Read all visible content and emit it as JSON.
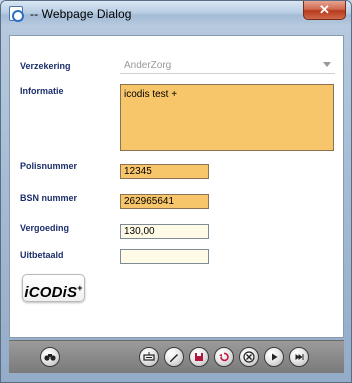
{
  "window": {
    "title": "-- Webpage Dialog",
    "close_label": "✕"
  },
  "form": {
    "verzekering_label": "Verzekering",
    "verzekering_value": "AnderZorg",
    "informatie_label": "Informatie",
    "informatie_value": "icodis test +",
    "polisnummer_label": "Polisnummer",
    "polisnummer_value": "12345",
    "bsn_label": "BSN nummer",
    "bsn_value": "262965641",
    "vergoeding_label": "Vergoeding",
    "vergoeding_value": "130,00",
    "uitbetaald_label": "Uitbetaald",
    "uitbetaald_value": ""
  },
  "logo": {
    "text": "iCODiS",
    "plus": "+"
  },
  "toolbar": {
    "buttons": [
      {
        "name": "search-icon"
      },
      {
        "name": "keyboard-icon"
      },
      {
        "name": "edit-icon"
      },
      {
        "name": "save-icon"
      },
      {
        "name": "undo-icon"
      },
      {
        "name": "delete-icon"
      },
      {
        "name": "next-icon"
      },
      {
        "name": "last-icon"
      }
    ]
  },
  "colors": {
    "field_orange": "#f8c66a",
    "label_navy": "#1c2f6b",
    "toolbar_gray": "#8a8a8a"
  }
}
